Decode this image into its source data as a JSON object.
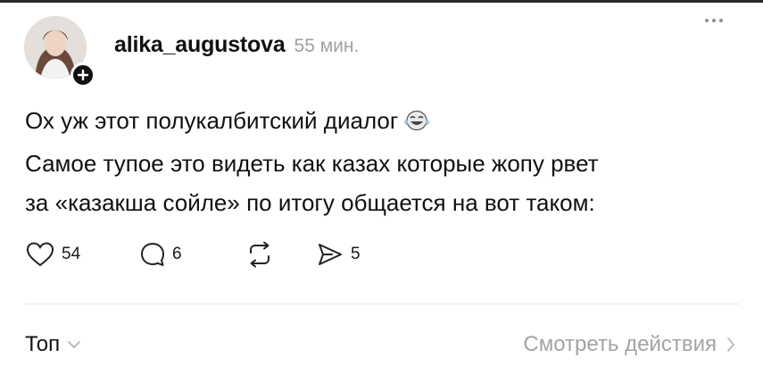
{
  "post": {
    "author": {
      "username": "alika_augustova",
      "time": "55 мин.",
      "avatar_icon": "profile-photo"
    },
    "lines": [
      "Ох уж этот полукалбитский диалог",
      "Самое тупое это видеть как казах которые жопу рвет",
      "за «казакша сойле» по итогу общается на вот таком:"
    ],
    "emoji": "tears-of-joy-emoji",
    "actions": {
      "likes": "54",
      "comments": "6",
      "shares": "5"
    }
  },
  "footer": {
    "sort_label": "Топ",
    "view_activity_label": "Смотреть действия"
  },
  "colors": {
    "text": "#111111",
    "muted": "#a0a0a0",
    "divider": "#e6e6e6"
  }
}
